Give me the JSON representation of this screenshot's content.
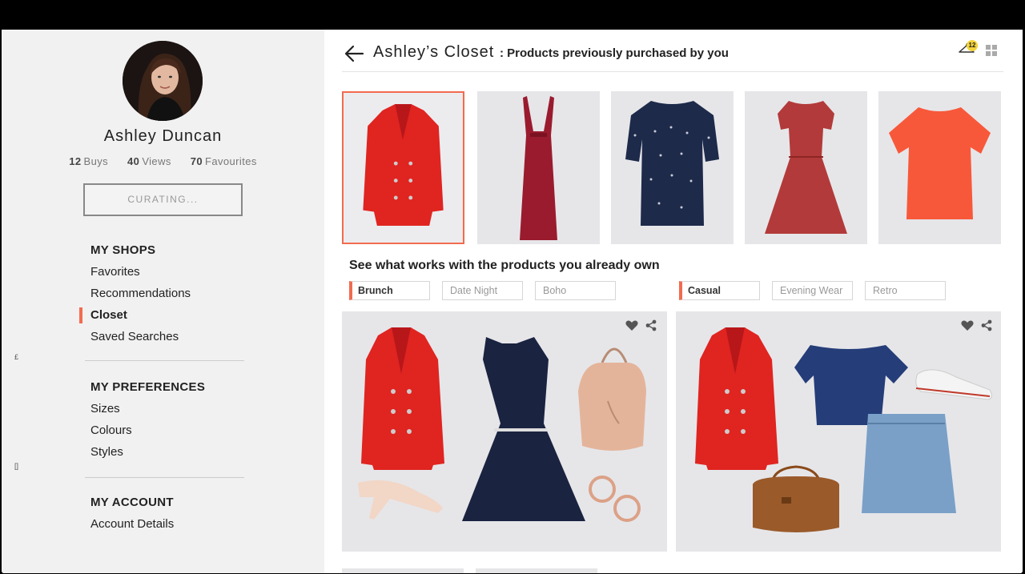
{
  "profile": {
    "name": "Ashley Duncan",
    "stats": [
      {
        "value": "12",
        "label": "Buys"
      },
      {
        "value": "40",
        "label": "Views"
      },
      {
        "value": "70",
        "label": "Favourites"
      }
    ],
    "curating_label": "CURATING..."
  },
  "nav": {
    "shops": {
      "title": "MY SHOPS",
      "items": [
        "Favorites",
        "Recommendations",
        "Closet",
        "Saved Searches"
      ],
      "active": "Closet"
    },
    "preferences": {
      "title": "MY PREFERENCES",
      "items": [
        "Sizes",
        "Colours",
        "Styles"
      ]
    },
    "account": {
      "title": "MY ACCOUNT",
      "items": [
        "Account Details"
      ]
    }
  },
  "edge_marks": [
    "£",
    "[]"
  ],
  "header": {
    "title": "Ashley’s Closet",
    "subtitle": ": Products previously purchased by you",
    "hanger_count": "12"
  },
  "closet": {
    "items": [
      {
        "name": "red blazer",
        "color": "#e02420",
        "selected": true
      },
      {
        "name": "maxi dress",
        "color": "#9a1b2e",
        "selected": false
      },
      {
        "name": "navy print top",
        "color": "#1d2a4a",
        "selected": false
      },
      {
        "name": "lace dress",
        "color": "#b33a3a",
        "selected": false
      },
      {
        "name": "coral tee",
        "color": "#f8583a",
        "selected": false
      }
    ]
  },
  "works_with": {
    "title": "See what works with the products you already own",
    "left_tags": [
      "Brunch",
      "Date Night",
      "Boho"
    ],
    "right_tags": [
      "Casual",
      "Evening Wear",
      "Retro"
    ],
    "active_left": "Brunch",
    "active_right": "Casual"
  },
  "colors": {
    "accent": "#f26b4f",
    "panel": "#e6e6e9",
    "sidebar": "#f1f1f1"
  },
  "icons": [
    "back-arrow-icon",
    "hanger-icon",
    "grid-icon",
    "heart-icon",
    "share-icon"
  ]
}
